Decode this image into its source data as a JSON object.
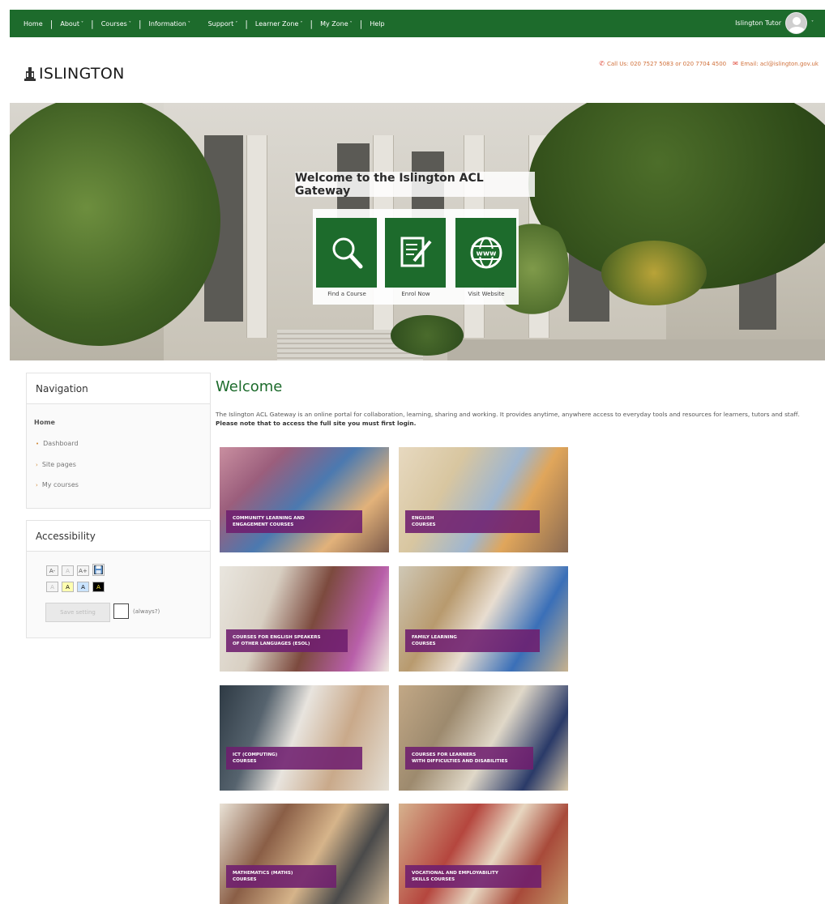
{
  "topnav": {
    "items": [
      {
        "label": "Home",
        "caret": ""
      },
      {
        "label": "About",
        "caret": "˅"
      },
      {
        "label": "Courses",
        "caret": "˅"
      },
      {
        "label": "Information",
        "caret": "˅"
      },
      {
        "label": "Support",
        "caret": "˅"
      },
      {
        "label": "Learner Zone",
        "caret": "˅"
      },
      {
        "label": "My Zone",
        "caret": "˅"
      },
      {
        "label": "Help",
        "caret": ""
      }
    ],
    "user_name": "Islington Tutor",
    "user_caret": "˅"
  },
  "header": {
    "logo_text": "ISLINGTON",
    "phone_text": "Call Us: 020 7527 5083 or 020 7704 4500",
    "email_text": "Email: acl@islington.gov.uk"
  },
  "hero": {
    "title": "Welcome to the Islington ACL Gateway",
    "tiles": [
      {
        "label": "Find a Course",
        "icon": "magnifier-icon"
      },
      {
        "label": "Enrol Now",
        "icon": "edit-form-icon"
      },
      {
        "label": "Visit Website",
        "icon": "www-globe-icon"
      }
    ]
  },
  "sidebar": {
    "navigation_title": "Navigation",
    "home_label": "Home",
    "links": [
      "Dashboard",
      "Site pages",
      "My courses"
    ],
    "accessibility_title": "Accessibility",
    "font_buttons": [
      "A-",
      "A",
      "A+"
    ],
    "color_buttons": [
      "A",
      "A",
      "A",
      "A"
    ],
    "save_label": "Save setting",
    "always_label": "(always?)"
  },
  "main": {
    "heading": "Welcome",
    "intro_text": "The Islington ACL Gateway is an online portal for collaboration, learning, sharing and working. It provides anytime, anywhere access to everyday tools and resources for learners, tutors and staff.",
    "intro_bold": "Please note that to access the full site you must first login.",
    "courses": [
      {
        "line1": "Community Learning and",
        "line2": "Engagement Courses"
      },
      {
        "line1": "English",
        "line2": "Courses"
      },
      {
        "line1": "Courses for English Speakers",
        "line2": "of Other Languages (ESOL)"
      },
      {
        "line1": "Family Learning",
        "line2": "Courses"
      },
      {
        "line1": "ICT (Computing)",
        "line2": "Courses"
      },
      {
        "line1": "Courses for Learners",
        "line2": "with Difficulties and Disabilities"
      },
      {
        "line1": "Mathematics (Maths)",
        "line2": "Courses"
      },
      {
        "line1": "Vocational and Employability",
        "line2": "Skills Courses"
      }
    ]
  },
  "colors": {
    "brand_green": "#1d6b2c",
    "course_band_purple": "#6e1e6e",
    "contact_orange": "#d0703a"
  }
}
